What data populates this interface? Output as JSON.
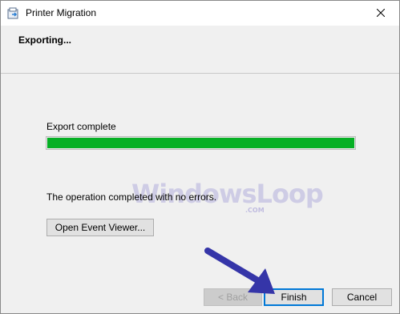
{
  "window": {
    "title": "Printer Migration",
    "app_icon": "printer-migration-icon",
    "close_icon": "close-icon"
  },
  "header": {
    "title": "Exporting..."
  },
  "progress": {
    "label": "Export complete",
    "fraction": 1.0,
    "color": "#06b025"
  },
  "message": "The operation completed with no errors.",
  "buttons": {
    "event_viewer": "Open Event Viewer...",
    "back": "< Back",
    "finish": "Finish",
    "cancel": "Cancel"
  },
  "watermark": {
    "text": "WindowsLoop",
    "sub": ".COM"
  },
  "annotation": {
    "color": "#3535a8"
  },
  "colors": {
    "accent": "#0078d7",
    "progress": "#06b025"
  }
}
